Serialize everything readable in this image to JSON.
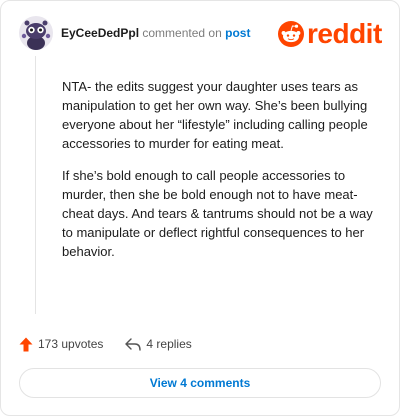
{
  "comment": {
    "username": "EyCeeDedPpl",
    "action_text": "commented on",
    "target_text": "post",
    "paragraphs": [
      "NTA- the edits suggest your daughter uses tears as manipulation to get her own way. She’s been bullying everyone about her “lifestyle” including calling people accessories to murder for eating meat.",
      "If she’s bold enough to call people accessories to murder, then she be bold enough not to have meat-cheat days. And tears & tantrums should not be a way to manipulate or deflect rightful consequences to her behavior."
    ]
  },
  "brand": {
    "logo_text": "reddit",
    "color": "#ff4500"
  },
  "stats": {
    "upvotes_label": "173 upvotes",
    "replies_label": "4 replies"
  },
  "view_button_label": "View 4 comments",
  "colors": {
    "link": "#0079d3",
    "upvote": "#ff4500",
    "text": "#1c1c1c",
    "muted": "#7c7c7c"
  },
  "icons": {
    "avatar": "snoo-avatar-icon",
    "upvote": "upvote-arrow-icon",
    "reply": "reply-arrow-icon",
    "logo": "reddit-alien-icon"
  }
}
